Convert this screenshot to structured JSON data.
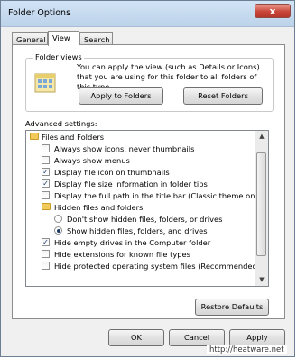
{
  "window": {
    "title": "Folder Options",
    "close_label": "x"
  },
  "tabs": [
    {
      "label": "General",
      "active": false
    },
    {
      "label": "View",
      "active": true
    },
    {
      "label": "Search",
      "active": false
    }
  ],
  "folder_views": {
    "caption": "Folder views",
    "text": "You can apply the view (such as Details or Icons) that you are using for this folder to all folders of this type.",
    "apply_label": "Apply to Folders",
    "reset_label": "Reset Folders"
  },
  "advanced": {
    "label": "Advanced settings:",
    "items": [
      {
        "type": "folder",
        "label": "Files and Folders"
      },
      {
        "type": "checkbox",
        "label": "Always show icons, never thumbnails",
        "checked": false
      },
      {
        "type": "checkbox",
        "label": "Always show menus",
        "checked": false
      },
      {
        "type": "checkbox",
        "label": "Display file icon on thumbnails",
        "checked": true
      },
      {
        "type": "checkbox",
        "label": "Display file size information in folder tips",
        "checked": true
      },
      {
        "type": "checkbox",
        "label": "Display the full path in the title bar (Classic theme only)",
        "checked": false
      },
      {
        "type": "folder",
        "label": "Hidden files and folders"
      },
      {
        "type": "radio",
        "label": "Don't show hidden files, folders, or drives",
        "checked": false
      },
      {
        "type": "radio",
        "label": "Show hidden files, folders, and drives",
        "checked": true
      },
      {
        "type": "checkbox",
        "label": "Hide empty drives in the Computer folder",
        "checked": true
      },
      {
        "type": "checkbox",
        "label": "Hide extensions for known file types",
        "checked": false
      },
      {
        "type": "checkbox",
        "label": "Hide protected operating system files (Recommended)",
        "checked": false
      }
    ],
    "restore_label": "Restore Defaults"
  },
  "footer": {
    "ok_label": "OK",
    "cancel_label": "Cancel",
    "apply_label": "Apply"
  },
  "watermark": "http://heatware.net"
}
